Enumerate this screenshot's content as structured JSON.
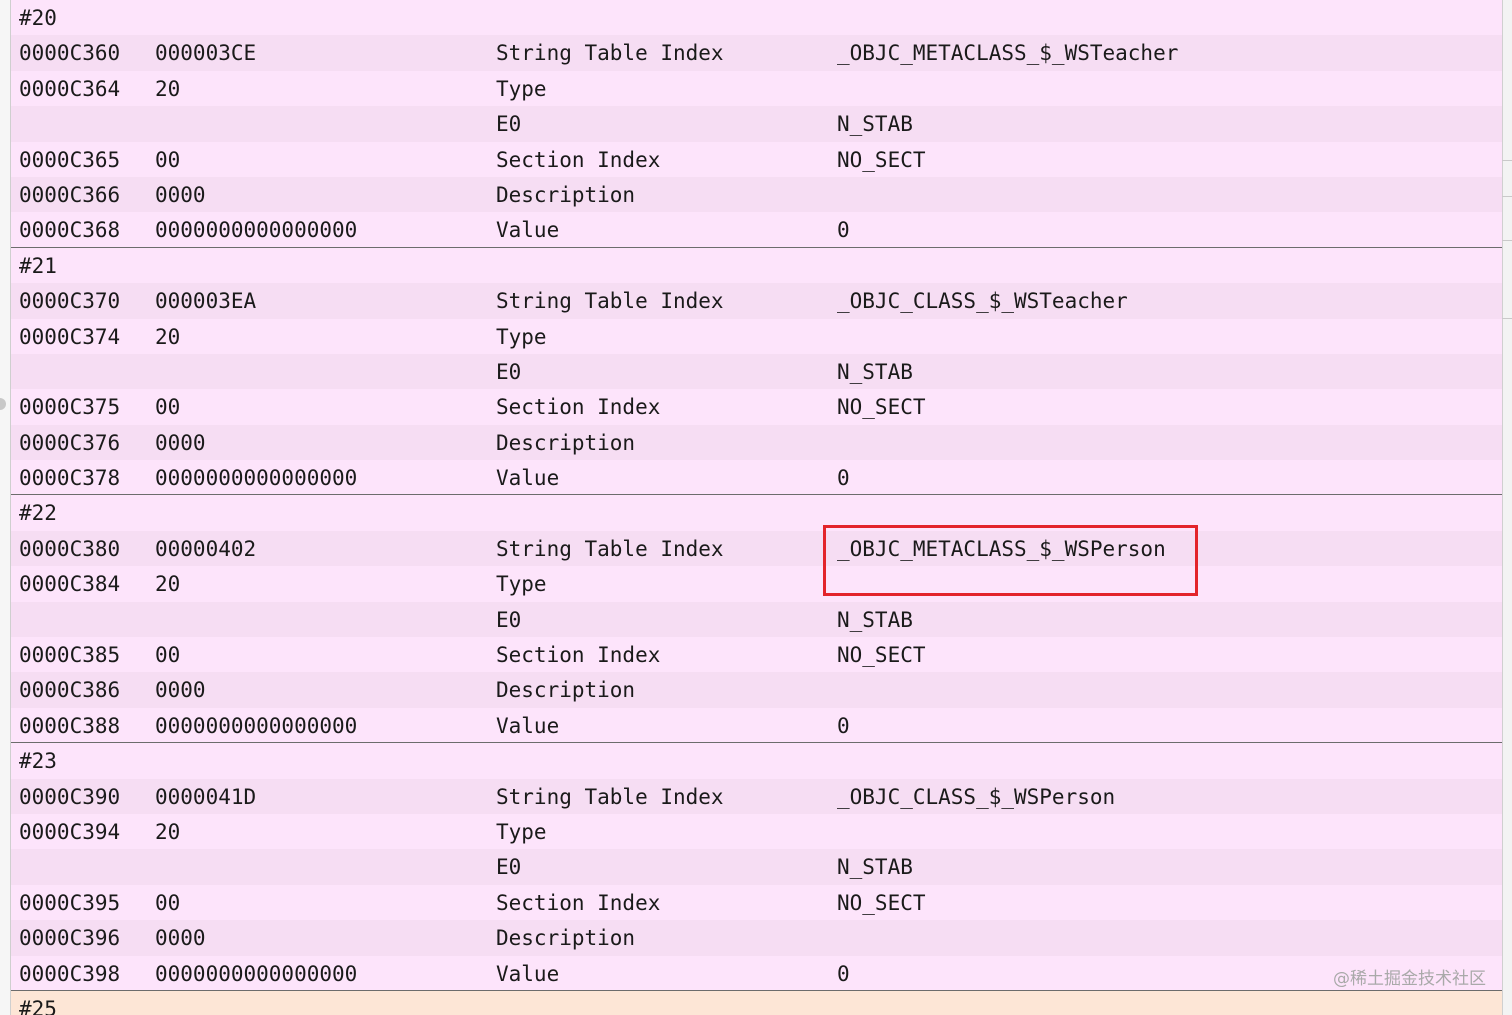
{
  "symbols": [
    {
      "index": "#20",
      "rows": [
        {
          "offset": "0000C360",
          "data": "000003CE",
          "description": "String Table Index",
          "value": "_OBJC_METACLASS_$_WSTeacher"
        },
        {
          "offset": "0000C364",
          "data": "20",
          "description": "Type",
          "value": ""
        },
        {
          "offset": "",
          "data": "",
          "description": "E0",
          "value": "N_STAB"
        },
        {
          "offset": "0000C365",
          "data": "00",
          "description": "Section Index",
          "value": "NO_SECT"
        },
        {
          "offset": "0000C366",
          "data": "0000",
          "description": "Description",
          "value": ""
        },
        {
          "offset": "0000C368",
          "data": "0000000000000000",
          "description": "Value",
          "value": "0"
        }
      ]
    },
    {
      "index": "#21",
      "rows": [
        {
          "offset": "0000C370",
          "data": "000003EA",
          "description": "String Table Index",
          "value": "_OBJC_CLASS_$_WSTeacher"
        },
        {
          "offset": "0000C374",
          "data": "20",
          "description": "Type",
          "value": ""
        },
        {
          "offset": "",
          "data": "",
          "description": "E0",
          "value": "N_STAB"
        },
        {
          "offset": "0000C375",
          "data": "00",
          "description": "Section Index",
          "value": "NO_SECT"
        },
        {
          "offset": "0000C376",
          "data": "0000",
          "description": "Description",
          "value": ""
        },
        {
          "offset": "0000C378",
          "data": "0000000000000000",
          "description": "Value",
          "value": "0"
        }
      ]
    },
    {
      "index": "#22",
      "rows": [
        {
          "offset": "0000C380",
          "data": "00000402",
          "description": "String Table Index",
          "value": "_OBJC_METACLASS_$_WSPerson"
        },
        {
          "offset": "0000C384",
          "data": "20",
          "description": "Type",
          "value": ""
        },
        {
          "offset": "",
          "data": "",
          "description": "E0",
          "value": "N_STAB"
        },
        {
          "offset": "0000C385",
          "data": "00",
          "description": "Section Index",
          "value": "NO_SECT"
        },
        {
          "offset": "0000C386",
          "data": "0000",
          "description": "Description",
          "value": ""
        },
        {
          "offset": "0000C388",
          "data": "0000000000000000",
          "description": "Value",
          "value": "0"
        }
      ]
    },
    {
      "index": "#23",
      "rows": [
        {
          "offset": "0000C390",
          "data": "0000041D",
          "description": "String Table Index",
          "value": "_OBJC_CLASS_$_WSPerson"
        },
        {
          "offset": "0000C394",
          "data": "20",
          "description": "Type",
          "value": ""
        },
        {
          "offset": "",
          "data": "",
          "description": "E0",
          "value": "N_STAB"
        },
        {
          "offset": "0000C395",
          "data": "00",
          "description": "Section Index",
          "value": "NO_SECT"
        },
        {
          "offset": "0000C396",
          "data": "0000",
          "description": "Description",
          "value": ""
        },
        {
          "offset": "0000C398",
          "data": "0000000000000000",
          "description": "Value",
          "value": "0"
        }
      ]
    }
  ],
  "next_index": "#25",
  "highlight": {
    "color": "#e3242b",
    "target": "_OBJC_METACLASS_$_WSPerson"
  },
  "watermark": "@稀土掘金技术社区"
}
